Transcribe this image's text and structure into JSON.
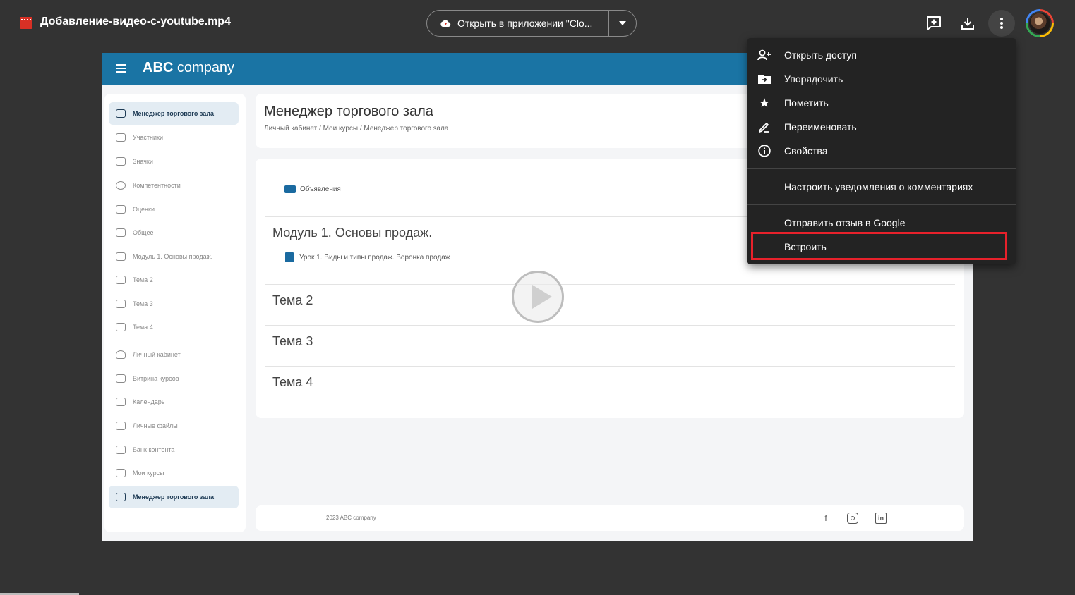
{
  "topbar": {
    "file_name": "Добавление-видео-с-youtube.mp4",
    "open_with_label": "Открыть в приложении \"Clo...",
    "icons": [
      "add-comment-icon",
      "download-icon",
      "more-vert-icon"
    ]
  },
  "video": {
    "brand_bold": "ABC",
    "brand_rest": "company",
    "sidebar": [
      {
        "label": "Менеджер торгового зала",
        "icon": "course-icon",
        "active": true
      },
      {
        "label": "Участники",
        "icon": "users-icon"
      },
      {
        "label": "Значки",
        "icon": "trophy-icon"
      },
      {
        "label": "Компетентности",
        "icon": "check-circle-icon"
      },
      {
        "label": "Оценки",
        "icon": "grid-icon"
      },
      {
        "label": "Общее",
        "icon": "folder-icon"
      },
      {
        "label": "Модуль 1. Основы продаж.",
        "icon": "folder-icon"
      },
      {
        "label": "Тема 2",
        "icon": "folder-icon"
      },
      {
        "label": "Тема 3",
        "icon": "folder-icon"
      },
      {
        "label": "Тема 4",
        "icon": "folder-icon"
      },
      {
        "label": "Личный кабинет",
        "icon": "person-icon"
      },
      {
        "label": "Витрина курсов",
        "icon": "list-icon"
      },
      {
        "label": "Календарь",
        "icon": "calendar-icon"
      },
      {
        "label": "Личные файлы",
        "icon": "file-icon"
      },
      {
        "label": "Банк контента",
        "icon": "database-icon"
      },
      {
        "label": "Мои курсы",
        "icon": "course-icon"
      },
      {
        "label": "Менеджер торгового зала",
        "icon": "course-icon",
        "active": true
      }
    ],
    "page_title": "Менеджер торгового зала",
    "breadcrumb": "Личный кабинет  /  Мои курсы  /  Менеджер торгового зала",
    "announcements": "Объявления",
    "module1": "Модуль 1. Основы продаж.",
    "lesson1": "Урок 1. Виды и типы продаж. Воронка продаж",
    "topic2": "Тема 2",
    "topic3": "Тема 3",
    "topic4": "Тема 4",
    "copyright": "2023 ABC company",
    "social": [
      "facebook-icon",
      "instagram-icon",
      "linkedin-icon"
    ]
  },
  "menu": {
    "items": [
      {
        "label": "Открыть доступ",
        "icon": "person-add-icon"
      },
      {
        "label": "Упорядочить",
        "icon": "folder-move-icon"
      },
      {
        "label": "Пометить",
        "icon": "star-icon"
      },
      {
        "label": "Переименовать",
        "icon": "pencil-icon"
      },
      {
        "label": "Свойства",
        "icon": "info-icon"
      },
      {
        "label": "Настроить уведомления о комментариях",
        "icon": ""
      },
      {
        "label": "Отправить отзыв в Google",
        "icon": ""
      },
      {
        "label": "Встроить",
        "icon": "",
        "highlighted": true
      }
    ],
    "highlight_color": "#e8212b"
  }
}
